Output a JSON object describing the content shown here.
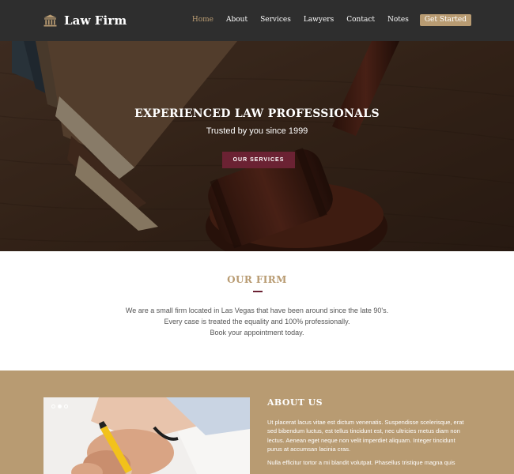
{
  "colors": {
    "nav_bg": "#2e2e2e",
    "accent": "#b89b72",
    "burgundy": "#6b2233",
    "about_bg": "#b89b72",
    "text_gray": "#555555"
  },
  "brand": {
    "name": "Law Firm",
    "icon": "courthouse-icon"
  },
  "nav": {
    "items": [
      {
        "label": "Home",
        "active": true
      },
      {
        "label": "About"
      },
      {
        "label": "Services"
      },
      {
        "label": "Lawyers"
      },
      {
        "label": "Contact"
      },
      {
        "label": "Notes"
      }
    ],
    "cta": "Get Started"
  },
  "hero": {
    "title": "EXPERIENCED LAW PROFESSIONALS",
    "subtitle": "Trusted by you since 1999",
    "button": "OUR SERVICES"
  },
  "firm": {
    "heading": "OUR FIRM",
    "lines": [
      "We are a small firm located in Las Vegas that have been around since the late 90's.",
      "Every case is treated the equality and 100% professionally.",
      "Book your appointment today."
    ]
  },
  "about": {
    "heading": "ABOUT US",
    "paragraphs": [
      "Ut placerat lacus vitae est dictum venenatis. Suspendisse scelerisque, erat sed bibendum luctus, est tellus tincidunt est, nec ultricies metus diam non lectus. Aenean eget neque non velit imperdiet aliquam. Integer tincidunt purus at accumsan lacinia cras.",
      "Nulla efficitur tortor a mi blandit volutpat. Phasellus tristique magna quis"
    ],
    "slider": {
      "slides": 3,
      "active": 2
    }
  }
}
